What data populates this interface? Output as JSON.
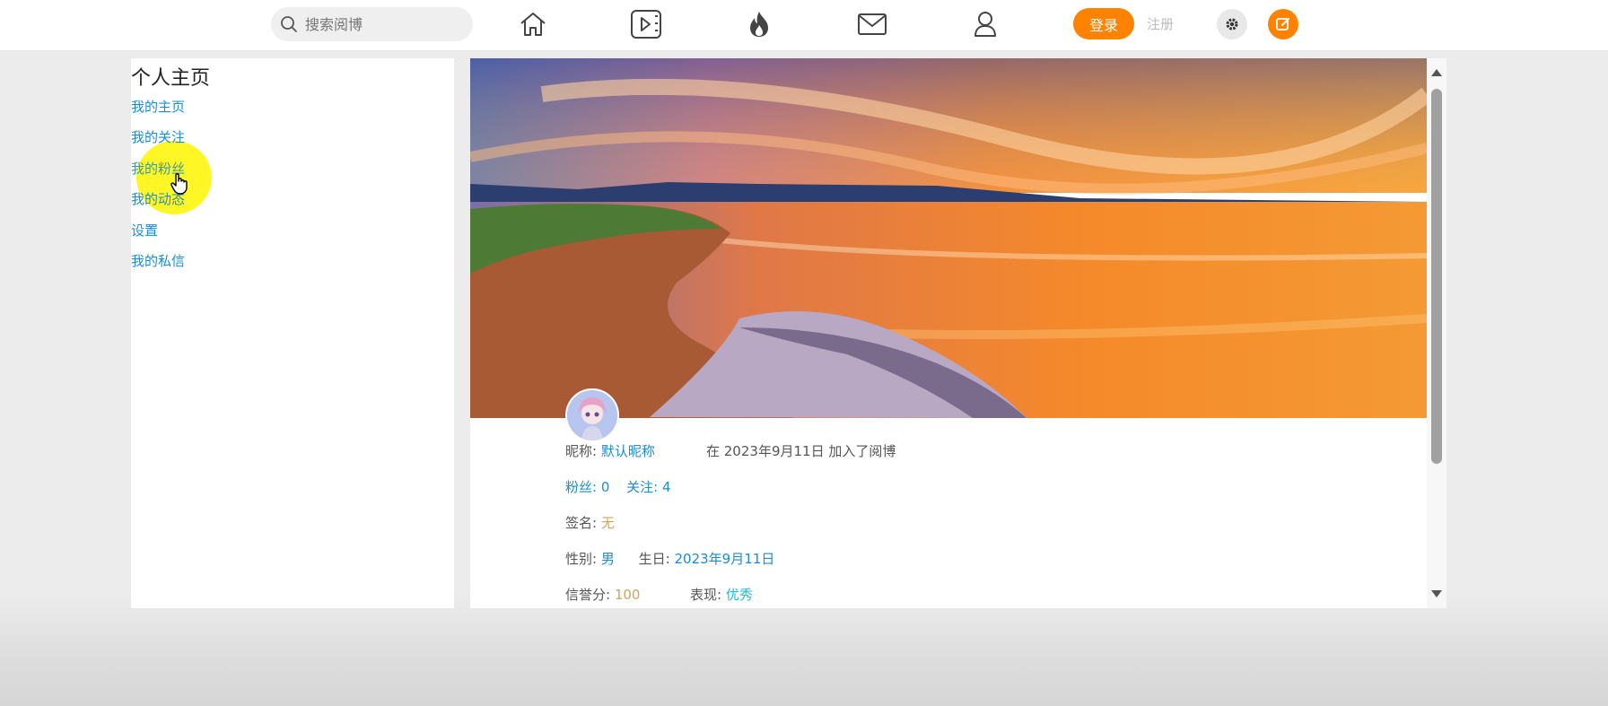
{
  "header": {
    "search_placeholder": "搜索阅博",
    "nav_icons": [
      "home-icon",
      "video-icon",
      "hot-icon",
      "mail-icon",
      "user-icon"
    ],
    "login_label": "登录",
    "register_label": "注册",
    "accent_color": "#ff8200"
  },
  "sidebar": {
    "title": "个人主页",
    "items": [
      {
        "label": "我的主页"
      },
      {
        "label": "我的关注"
      },
      {
        "label": "我的粉丝"
      },
      {
        "label": "我的动态"
      },
      {
        "label": "设置"
      },
      {
        "label": "我的私信"
      }
    ]
  },
  "profile": {
    "nickname_label": "昵称:",
    "nickname": "默认昵称",
    "joined_text": "在 2023年9月11日 加入了阅博",
    "fans_label": "粉丝:",
    "fans_count": "0",
    "follow_label": "关注:",
    "follow_count": "4",
    "signature_label": "签名:",
    "signature": "无",
    "gender_label": "性别:",
    "gender": "男",
    "birthday_label": "生日:",
    "birthday": "2023年9月11日",
    "credit_label": "信誉分:",
    "credit": "100",
    "performance_label": "表现:",
    "performance": "优秀"
  }
}
